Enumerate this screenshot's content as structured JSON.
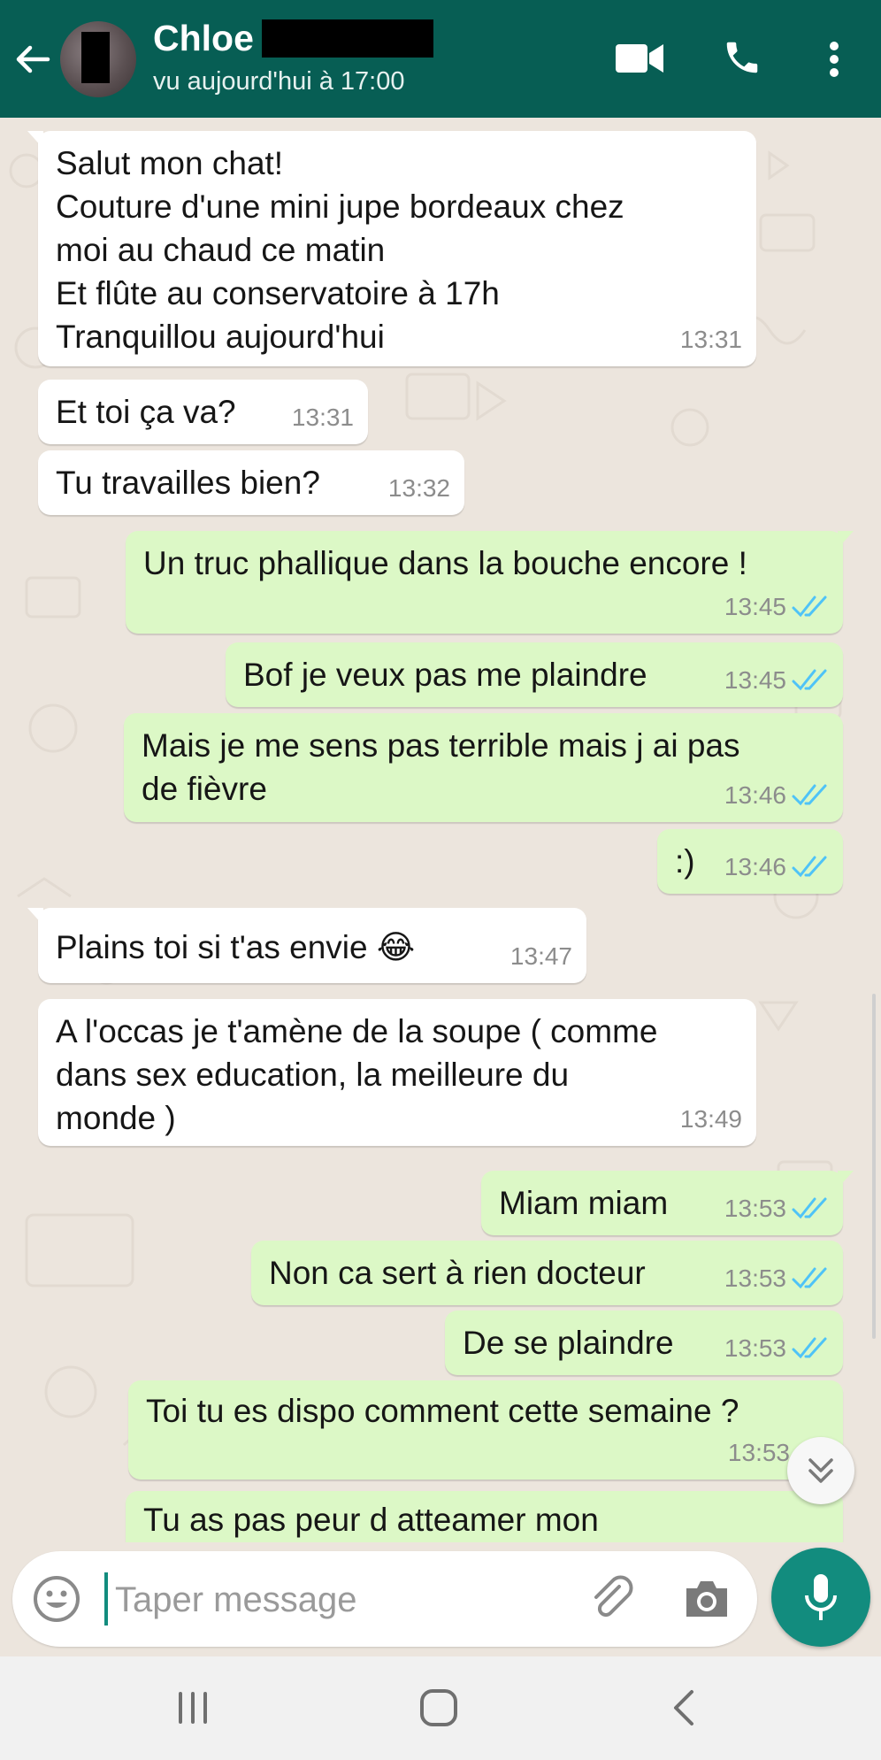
{
  "header": {
    "contact_name": "Chloe",
    "last_seen": "vu aujourd'hui à 17:00",
    "color": "#075e54"
  },
  "messages": [
    {
      "dir": "in",
      "text": "Salut mon chat!\nCouture d'une mini jupe bordeaux chez\nmoi au chaud ce matin\nEt flûte au conservatoire à 17h\nTranquillou aujourd'hui",
      "time": "13:31"
    },
    {
      "dir": "in",
      "text": "Et toi ça va?",
      "time": "13:31"
    },
    {
      "dir": "in",
      "text": "Tu travailles bien?",
      "time": "13:32"
    },
    {
      "dir": "out",
      "text": "Un truc phallique dans la bouche encore !",
      "time": "13:45",
      "read": true
    },
    {
      "dir": "out",
      "text": "Bof je veux pas me plaindre",
      "time": "13:45",
      "read": true
    },
    {
      "dir": "out",
      "text": "Mais je me sens pas terrible mais j ai pas\nde fièvre",
      "time": "13:46",
      "read": true
    },
    {
      "dir": "out",
      "text": ":)",
      "time": "13:46",
      "read": true
    },
    {
      "dir": "in",
      "text": "Plains toi si t'as envie 😂",
      "time": "13:47"
    },
    {
      "dir": "in",
      "text": "A l'occas je t'amène de la soupe ( comme\ndans sex education, la meilleure du\nmonde )",
      "time": "13:49"
    },
    {
      "dir": "out",
      "text": "Miam miam",
      "time": "13:53",
      "read": true
    },
    {
      "dir": "out",
      "text": "Non ca sert à rien docteur",
      "time": "13:53",
      "read": true
    },
    {
      "dir": "out",
      "text": "De se plaindre",
      "time": "13:53",
      "read": true
    },
    {
      "dir": "out",
      "text": "Toi tu es dispo comment cette semaine ?",
      "time": "13:53",
      "read": true
    },
    {
      "dir": "out",
      "text": "Tu as pas peur d atteamer mon",
      "time": "",
      "read": false
    }
  ],
  "composer": {
    "placeholder": "Taper message"
  },
  "icons": {
    "back": "back-arrow-icon",
    "video": "video-call-icon",
    "call": "phone-icon",
    "menu": "more-vert-icon",
    "emoji": "emoji-icon",
    "attach": "paperclip-icon",
    "camera": "camera-icon",
    "mic": "microphone-icon",
    "scroll": "double-chevron-down-icon"
  },
  "colors": {
    "incoming_bubble": "#ffffff",
    "outgoing_bubble": "#dcf8c6",
    "read_ticks": "#4fc3f7",
    "accent": "#128c7e",
    "wallpaper": "#ece5dd"
  }
}
